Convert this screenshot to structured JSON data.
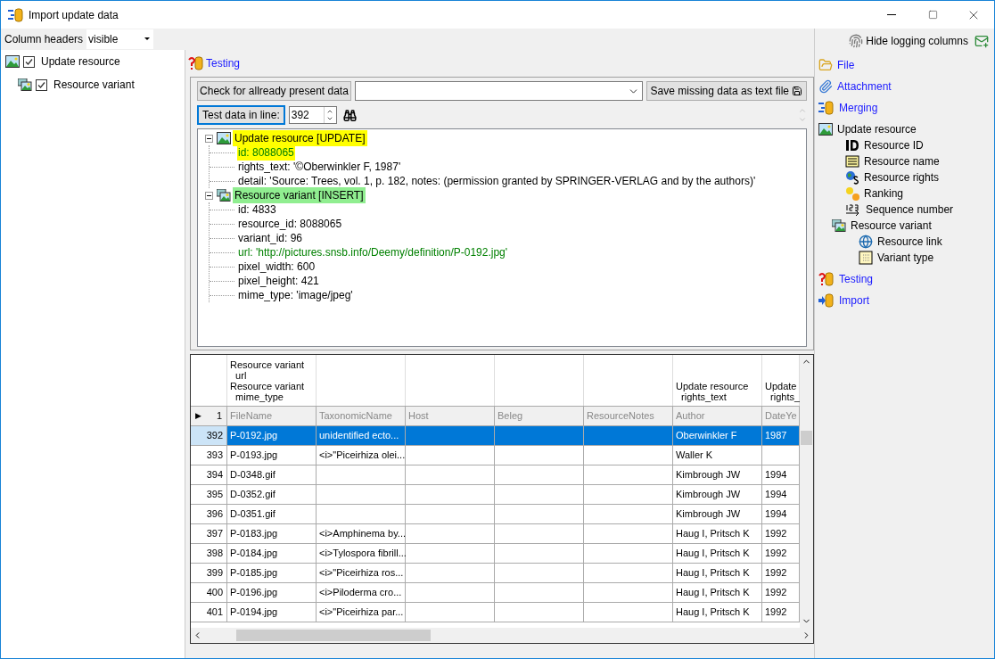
{
  "window": {
    "title": "Import update data"
  },
  "column_headers": {
    "label": "Column headers",
    "value": "visible"
  },
  "hide_logging": {
    "label": "Hide logging columns"
  },
  "tables_tree": [
    {
      "label": "Update resource",
      "checked": true,
      "children": [
        {
          "label": "Resource variant",
          "checked": true
        }
      ]
    }
  ],
  "section": {
    "title": "Testing"
  },
  "check_button": "Check for allready present data",
  "save_button": "Save missing data as text file",
  "test_button": "Test data in line:",
  "test_line": "392",
  "result_tree": [
    {
      "label": "Update resource [UPDATE]",
      "color": "#ffff00",
      "kind": "image",
      "children": [
        {
          "label": "id: 8088065",
          "color": "#008000",
          "highlighted": true
        },
        {
          "label": "rights_text: '©Oberwinkler F, 1987'",
          "highlighted": false
        },
        {
          "label": "detail: 'Source: Trees, vol. 1, p. 182, notes: (permission granted by SPRINGER-VERLAG and by the authors)'",
          "highlighted": false
        }
      ]
    },
    {
      "label": "Resource variant [INSERT]",
      "color": "#90ee90",
      "kind": "images",
      "children": [
        {
          "label": "id: 4833",
          "highlighted": false
        },
        {
          "label": "resource_id: 8088065",
          "highlighted": false
        },
        {
          "label": "variant_id: 96",
          "highlighted": false
        },
        {
          "label": "url: 'http://pictures.snsb.info/Deemy/definition/P-0192.jpg'",
          "color": "#008000",
          "highlighted": false
        },
        {
          "label": "pixel_width: 600",
          "highlighted": false
        },
        {
          "label": "pixel_height: 421",
          "highlighted": false
        },
        {
          "label": "mime_type: 'image/jpeg'",
          "highlighted": false
        }
      ]
    }
  ],
  "grid": {
    "first_row": {
      "marker": "▶",
      "number": "1"
    },
    "columns": [
      {
        "header": "Resource variant\n  url\nResource variant\n  mime_type",
        "field": "FileName"
      },
      {
        "field": "TaxonomicName"
      },
      {
        "field": "Host"
      },
      {
        "field": "Beleg"
      },
      {
        "field": "ResourceNotes"
      },
      {
        "header": "Update resource\n  rights_text",
        "field": "Author"
      },
      {
        "header": "Update\n  rights_",
        "field": "DateYe"
      }
    ],
    "rows": [
      {
        "number": "392",
        "selected": true,
        "cells": [
          "P-0192.jpg",
          "unidentified ecto...",
          null,
          null,
          null,
          "Oberwinkler F",
          "1987"
        ]
      },
      {
        "number": "393",
        "selected": false,
        "cells": [
          "P-0193.jpg",
          "<i>\"Piceirhiza olei...",
          null,
          null,
          null,
          "Waller K",
          null
        ]
      },
      {
        "number": "394",
        "selected": false,
        "cells": [
          "D-0348.gif",
          null,
          null,
          null,
          null,
          "Kimbrough JW",
          "1994"
        ]
      },
      {
        "number": "395",
        "selected": false,
        "cells": [
          "D-0352.gif",
          null,
          null,
          null,
          null,
          "Kimbrough JW",
          "1994"
        ]
      },
      {
        "number": "396",
        "selected": false,
        "cells": [
          "D-0351.gif",
          null,
          null,
          null,
          null,
          "Kimbrough JW",
          "1994"
        ]
      },
      {
        "number": "397",
        "selected": false,
        "cells": [
          "P-0183.jpg",
          "<i>Amphinema by...",
          null,
          null,
          null,
          "Haug I, Pritsch K",
          "1992"
        ]
      },
      {
        "number": "398",
        "selected": false,
        "cells": [
          "P-0184.jpg",
          "<i>Tylospora fibrill...",
          null,
          null,
          null,
          "Haug I, Pritsch K",
          "1992"
        ]
      },
      {
        "number": "399",
        "selected": false,
        "cells": [
          "P-0185.jpg",
          "<i>\"Piceirhiza ros...",
          null,
          null,
          null,
          "Haug I, Pritsch K",
          "1992"
        ]
      },
      {
        "number": "400",
        "selected": false,
        "cells": [
          "P-0196.jpg",
          "<i>Piloderma cro...",
          null,
          null,
          null,
          "Haug I, Pritsch K",
          "1992"
        ]
      },
      {
        "number": "401",
        "selected": false,
        "cells": [
          "P-0194.jpg",
          "<i>\"Piceirhiza par...",
          null,
          null,
          null,
          "Haug I, Pritsch K",
          "1992"
        ]
      }
    ]
  },
  "nav": [
    {
      "label": "File",
      "kind": "link"
    },
    {
      "label": "Attachment",
      "kind": "link"
    },
    {
      "label": "Merging",
      "kind": "link"
    },
    {
      "label": "Update resource",
      "kind": "table",
      "children": [
        {
          "label": "Resource ID",
          "kind": "field"
        },
        {
          "label": "Resource name",
          "kind": "field"
        },
        {
          "label": "Resource rights",
          "kind": "field"
        },
        {
          "label": "Ranking",
          "kind": "field"
        },
        {
          "label": "Sequence number",
          "kind": "field"
        },
        {
          "label": "Resource variant",
          "kind": "table",
          "children": [
            {
              "label": "Resource link",
              "kind": "field"
            },
            {
              "label": "Variant type",
              "kind": "field"
            }
          ]
        }
      ]
    },
    {
      "label": "Testing",
      "kind": "link"
    },
    {
      "label": "Import",
      "kind": "link"
    }
  ]
}
